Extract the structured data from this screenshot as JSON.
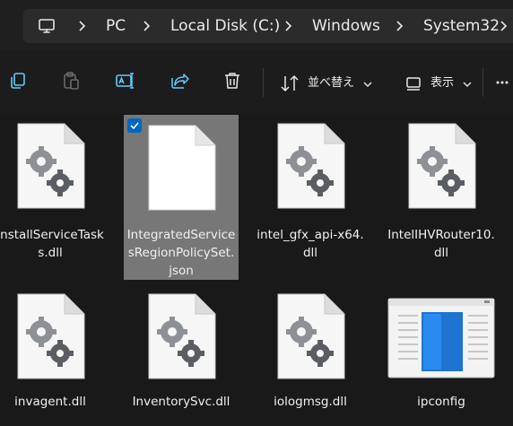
{
  "breadcrumb": {
    "items": [
      "PC",
      "Local Disk (C:)",
      "Windows",
      "System32"
    ]
  },
  "toolbar": {
    "sort_label": "並べ替え",
    "view_label": "表示"
  },
  "files": [
    {
      "name": "InstallServiceTasks.dll",
      "line1": "InstallServiceTask",
      "line2": "s.dll",
      "line3": "",
      "type": "dll",
      "selected": false
    },
    {
      "name": "IntegratedServicesRegionPolicySet.json",
      "line1": "IntegratedService",
      "line2": "sRegionPolicySet.",
      "line3": "json",
      "type": "json",
      "selected": true
    },
    {
      "name": "intel_gfx_api-x64.dll",
      "line1": "intel_gfx_api-x64.",
      "line2": "dll",
      "line3": "",
      "type": "dll",
      "selected": false
    },
    {
      "name": "IntelIHVRouter10.dll",
      "line1": "IntelIHVRouter10.",
      "line2": "dll",
      "line3": "",
      "type": "dll",
      "selected": false
    },
    {
      "name": "invagent.dll",
      "line1": "invagent.dll",
      "line2": "",
      "line3": "",
      "type": "dll",
      "selected": false
    },
    {
      "name": "InventorySvc.dll",
      "line1": "InventorySvc.dll",
      "line2": "",
      "line3": "",
      "type": "dll",
      "selected": false
    },
    {
      "name": "iologmsg.dll",
      "line1": "iologmsg.dll",
      "line2": "",
      "line3": "",
      "type": "dll",
      "selected": false
    },
    {
      "name": "ipconfig",
      "line1": "ipconfig",
      "line2": "",
      "line3": "",
      "type": "exe",
      "selected": false
    }
  ],
  "colors": {
    "background": "#191919",
    "selection": "#777777",
    "accent": "#0067c0"
  }
}
